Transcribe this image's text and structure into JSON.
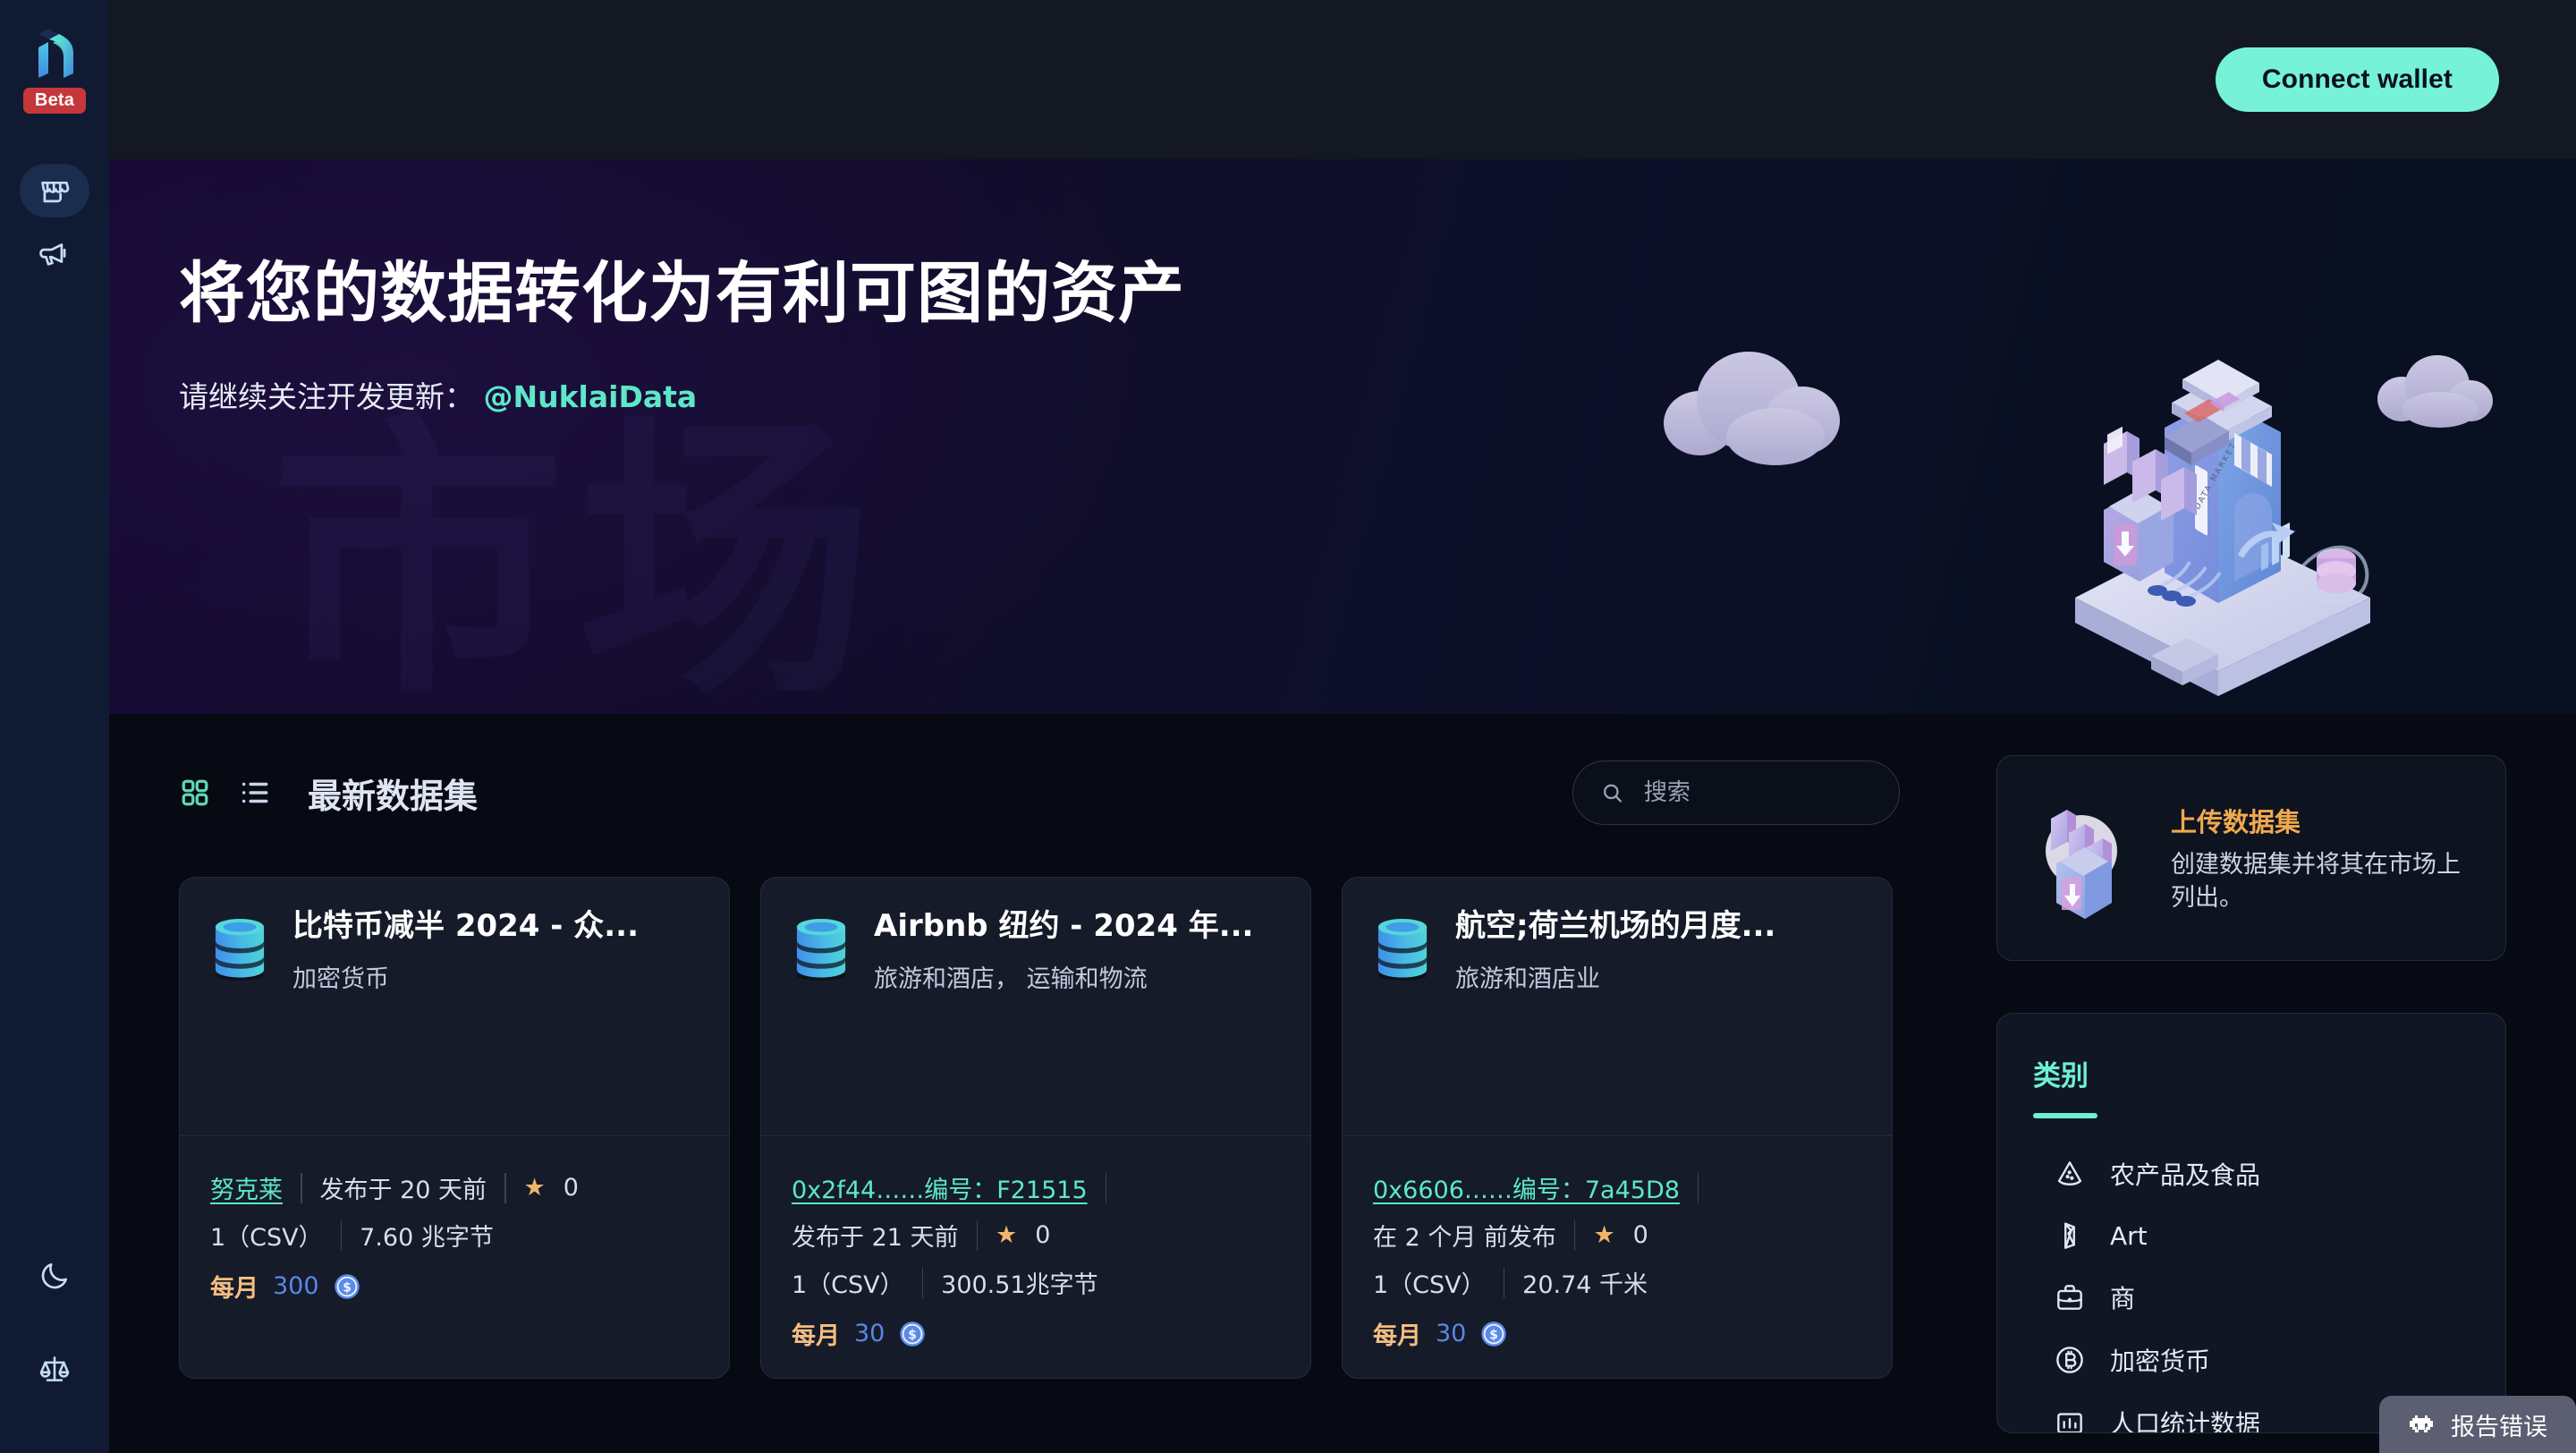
{
  "brand": {
    "logo_alt": "nuklai-logo",
    "beta_label": "Beta"
  },
  "sidebar": {
    "items": [
      {
        "icon": "marketplace-icon",
        "label": "Marketplace",
        "active": true
      },
      {
        "icon": "megaphone-icon",
        "label": "Announcements",
        "active": false
      }
    ],
    "bottom_items": [
      {
        "icon": "moon-icon",
        "label": "Dark mode"
      },
      {
        "icon": "scales-icon",
        "label": "Legal"
      }
    ]
  },
  "topbar": {
    "connect_wallet_label": "Connect wallet"
  },
  "hero": {
    "title": "将您的数据转化为有利可图的资产",
    "subtitle_prefix": "请继续关注开发更新：",
    "handle": "@NuklaiData",
    "watermark": "市场",
    "illustration_label": "DATA MARKET"
  },
  "section": {
    "title": "最新数据集",
    "grid_view_icon": "grid-view-icon",
    "list_view_icon": "list-view-icon",
    "active_view": "grid"
  },
  "search": {
    "placeholder": "搜索",
    "value": "",
    "icon": "search-icon"
  },
  "upload": {
    "title": "上传数据集",
    "description": "创建数据集并将其在市场上列出。",
    "icon": "upload-box-icon"
  },
  "categories": {
    "title": "类别",
    "items": [
      {
        "icon": "watermelon-icon",
        "label": "农产品及食品"
      },
      {
        "icon": "art-prism-icon",
        "label": "Art"
      },
      {
        "icon": "briefcase-icon",
        "label": "商"
      },
      {
        "icon": "bitcoin-icon",
        "label": "加密货币"
      },
      {
        "icon": "chart-bars-icon",
        "label": "人口统计数据"
      }
    ]
  },
  "datasets": [
    {
      "title": "比特币减半 2024 - 众...",
      "category": "加密货币",
      "owner": "努克莱",
      "owner_is_link": true,
      "address": "",
      "published": "发布于 20 天前",
      "stars": "0",
      "files": "1（CSV）",
      "size": "7.60 兆字节",
      "price_label": "每月",
      "price_value": "300",
      "price_coin": "usdc-coin-icon"
    },
    {
      "title": "Airbnb 纽约 - 2024 年...",
      "category": "旅游和酒店， 运输和物流",
      "owner": "",
      "owner_is_link": true,
      "address": "0x2f44……编号：F21515",
      "published": "发布于 21 天前",
      "stars": "0",
      "files": "1（CSV）",
      "size": "300.51兆字节",
      "price_label": "每月",
      "price_value": "30",
      "price_coin": "usdc-coin-icon"
    },
    {
      "title": "航空;荷兰机场的月度...",
      "category": "旅游和酒店业",
      "owner": "",
      "owner_is_link": true,
      "address": "0x6606……编号：7a45D8",
      "published": "在 2 个月 前发布",
      "stars": "0",
      "files": "1（CSV）",
      "size": "20.74 千米",
      "price_label": "每月",
      "price_value": "30",
      "price_coin": "usdc-coin-icon"
    }
  ],
  "report_bug": {
    "label": "报告错误",
    "icon": "bug-invader-icon"
  },
  "colors": {
    "accent_mint": "#75f2d8",
    "accent_orange": "#f0a94d",
    "link_blue": "#5a86e8",
    "beta_red": "#c5373a",
    "sidebar_bg": "#101a32",
    "card_bg": "#151b28",
    "page_bg": "#070a12"
  }
}
